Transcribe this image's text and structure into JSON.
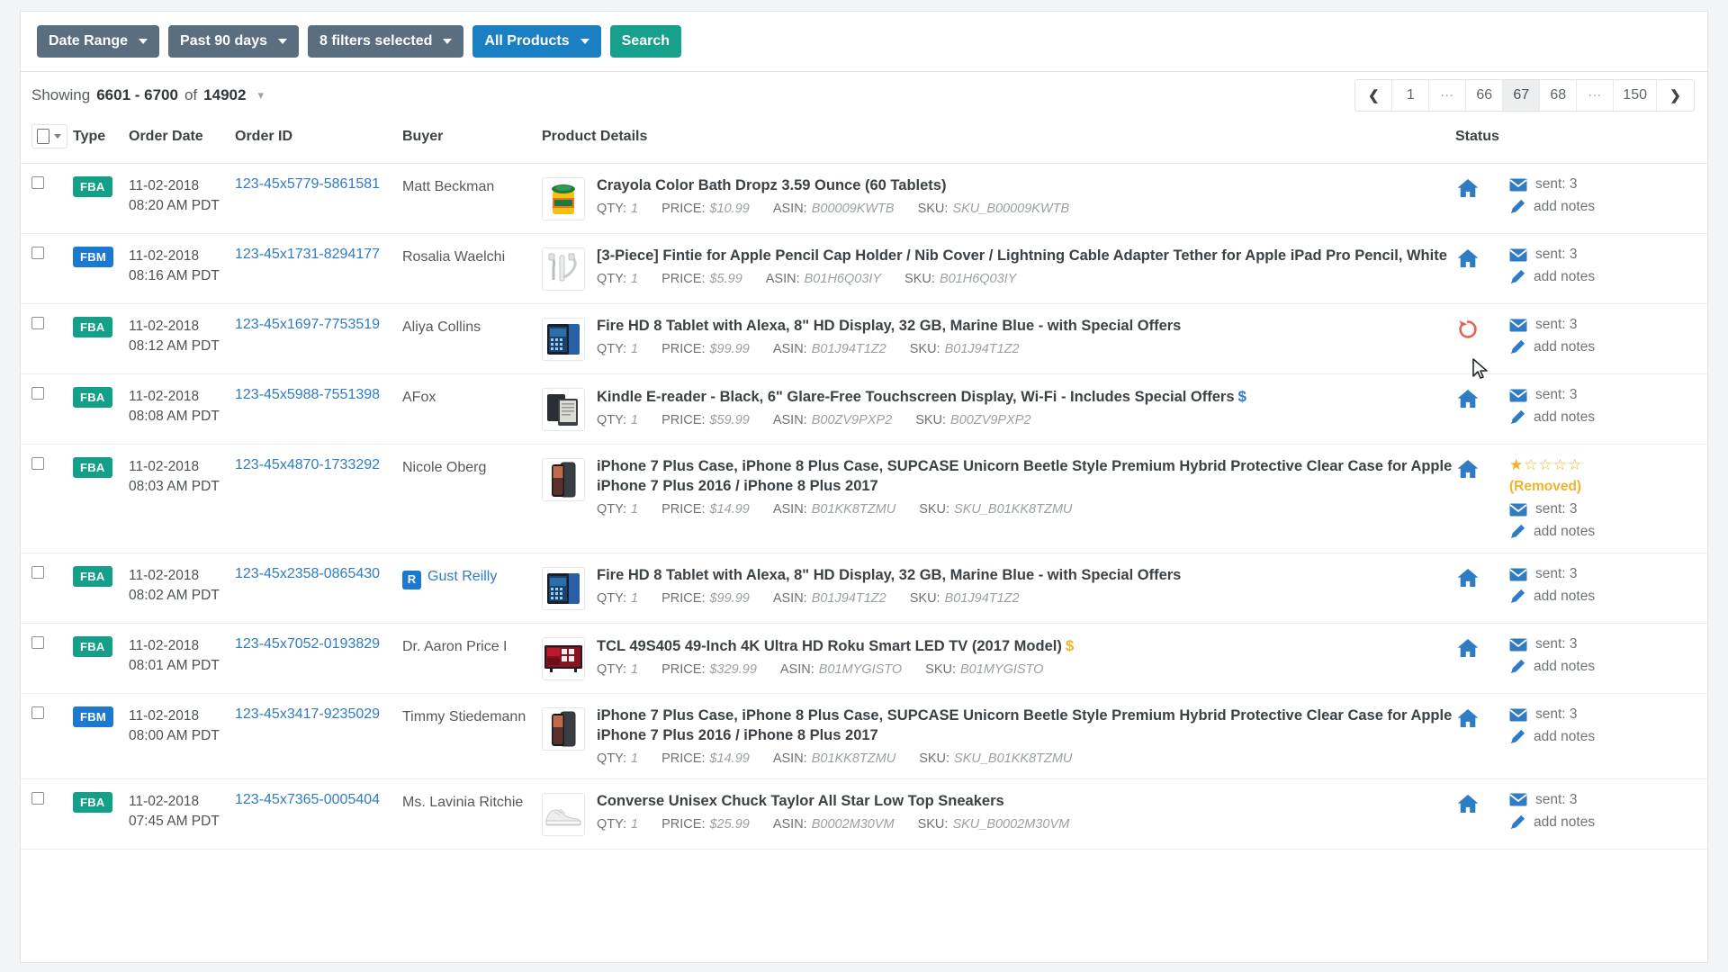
{
  "filters": {
    "date_range_label": "Date Range",
    "period_label": "Past 90 days",
    "filters_label": "8 filters selected",
    "products_label": "All Products",
    "search_label": "Search",
    "colors": {
      "grey": "#5a6e7f",
      "blue": "#1b7fc4",
      "teal": "#17a08c"
    }
  },
  "toolbar": {
    "showing_word": "Showing",
    "range": "6601 - 6700",
    "of_word": "of",
    "total": "14902",
    "pagination": {
      "prev": "‹",
      "next": "›",
      "pages": [
        "1",
        "...",
        "66",
        "67",
        "68",
        "...",
        "150"
      ],
      "active": "67"
    }
  },
  "table": {
    "headers": {
      "type": "Type",
      "order_date": "Order Date",
      "order_id": "Order ID",
      "buyer": "Buyer",
      "product_details": "Product Details",
      "status": "Status"
    },
    "labels": {
      "qty": "QTY:",
      "price": "PRICE:",
      "asin": "ASIN:",
      "sku": "SKU:"
    },
    "rows": [
      {
        "type": "FBA",
        "date": "11-02-2018",
        "time": "08:20 AM PDT",
        "order_id": "123-45x5779-5861581",
        "buyer": "Matt Beckman",
        "buyer_badge": "",
        "thumb": "crayola-bath-dropz-thumb",
        "title": "Crayola Color Bath Dropz 3.59 Ounce (60 Tablets)",
        "dollar": "",
        "qty": "1",
        "price": "$10.99",
        "asin": "B00009KWTB",
        "sku": "SKU_B00009KWTB",
        "status_icon": "home-icon",
        "stars": 0,
        "removed": "",
        "sent": "sent: 3",
        "notes": "add notes"
      },
      {
        "type": "FBM",
        "date": "11-02-2018",
        "time": "08:16 AM PDT",
        "order_id": "123-45x1731-8294177",
        "buyer": "Rosalia Waelchi",
        "buyer_badge": "",
        "thumb": "pencil-cap-holder-thumb",
        "title": "[3-Piece] Fintie for Apple Pencil Cap Holder / Nib Cover / Lightning Cable Adapter Tether for Apple iPad Pro Pencil, White",
        "dollar": "",
        "qty": "1",
        "price": "$5.99",
        "asin": "B01H6Q03IY",
        "sku": "B01H6Q03IY",
        "status_icon": "home-icon",
        "stars": 0,
        "removed": "",
        "sent": "sent: 3",
        "notes": "add notes"
      },
      {
        "type": "FBA",
        "date": "11-02-2018",
        "time": "08:12 AM PDT",
        "order_id": "123-45x1697-7753519",
        "buyer": "Aliya Collins",
        "buyer_badge": "",
        "thumb": "fire-tablet-thumb",
        "title": "Fire HD 8 Tablet with Alexa, 8\" HD Display, 32 GB, Marine Blue - with Special Offers",
        "dollar": "",
        "qty": "1",
        "price": "$99.99",
        "asin": "B01J94T1Z2",
        "sku": "B01J94T1Z2",
        "status_icon": "refund-icon",
        "stars": 0,
        "removed": "",
        "sent": "sent: 3",
        "notes": "add notes"
      },
      {
        "type": "FBA",
        "date": "11-02-2018",
        "time": "08:08 AM PDT",
        "order_id": "123-45x5988-7551398",
        "buyer": "AFox",
        "buyer_badge": "",
        "thumb": "kindle-ereader-thumb",
        "title": "Kindle E-reader - Black, 6\" Glare-Free Touchscreen Display, Wi-Fi - Includes Special Offers",
        "dollar": "blue",
        "qty": "1",
        "price": "$59.99",
        "asin": "B00ZV9PXP2",
        "sku": "B00ZV9PXP2",
        "status_icon": "home-icon",
        "stars": 0,
        "removed": "",
        "sent": "sent: 3",
        "notes": "add notes"
      },
      {
        "type": "FBA",
        "date": "11-02-2018",
        "time": "08:03 AM PDT",
        "order_id": "123-45x4870-1733292",
        "buyer": "Nicole Oberg",
        "buyer_badge": "",
        "thumb": "iphone-case-thumb",
        "title": "iPhone 7 Plus Case, iPhone 8 Plus Case, SUPCASE Unicorn Beetle Style Premium Hybrid Protective Clear Case for Apple iPhone 7 Plus 2016 / iPhone 8 Plus 2017",
        "dollar": "",
        "qty": "1",
        "price": "$14.99",
        "asin": "B01KK8TZMU",
        "sku": "SKU_B01KK8TZMU",
        "status_icon": "home-icon",
        "stars": 1,
        "removed": "(Removed)",
        "sent": "sent: 3",
        "notes": "add notes"
      },
      {
        "type": "FBA",
        "date": "11-02-2018",
        "time": "08:02 AM PDT",
        "order_id": "123-45x2358-0865430",
        "buyer": "Gust Reilly",
        "buyer_badge": "R",
        "thumb": "fire-tablet-thumb",
        "title": "Fire HD 8 Tablet with Alexa, 8\" HD Display, 32 GB, Marine Blue - with Special Offers",
        "dollar": "",
        "qty": "1",
        "price": "$99.99",
        "asin": "B01J94T1Z2",
        "sku": "B01J94T1Z2",
        "status_icon": "home-icon",
        "stars": 0,
        "removed": "",
        "sent": "sent: 3",
        "notes": "add notes"
      },
      {
        "type": "FBA",
        "date": "11-02-2018",
        "time": "08:01 AM PDT",
        "order_id": "123-45x7052-0193829",
        "buyer": "Dr. Aaron Price I",
        "buyer_badge": "",
        "thumb": "tcl-tv-thumb",
        "title": "TCL 49S405 49-Inch 4K Ultra HD Roku Smart LED TV (2017 Model)",
        "dollar": "gold",
        "qty": "1",
        "price": "$329.99",
        "asin": "B01MYGISTO",
        "sku": "B01MYGISTO",
        "status_icon": "home-icon",
        "stars": 0,
        "removed": "",
        "sent": "sent: 3",
        "notes": "add notes"
      },
      {
        "type": "FBM",
        "date": "11-02-2018",
        "time": "08:00 AM PDT",
        "order_id": "123-45x3417-9235029",
        "buyer": "Timmy Stiedemann",
        "buyer_badge": "",
        "thumb": "iphone-case-thumb",
        "title": "iPhone 7 Plus Case, iPhone 8 Plus Case, SUPCASE Unicorn Beetle Style Premium Hybrid Protective Clear Case for Apple iPhone 7 Plus 2016 / iPhone 8 Plus 2017",
        "dollar": "",
        "qty": "1",
        "price": "$14.99",
        "asin": "B01KK8TZMU",
        "sku": "SKU_B01KK8TZMU",
        "status_icon": "home-icon",
        "stars": 0,
        "removed": "",
        "sent": "sent: 3",
        "notes": "add notes"
      },
      {
        "type": "FBA",
        "date": "11-02-2018",
        "time": "07:45 AM PDT",
        "order_id": "123-45x7365-0005404",
        "buyer": "Ms. Lavinia Ritchie",
        "buyer_badge": "",
        "thumb": "converse-sneaker-thumb",
        "title": "Converse Unisex Chuck Taylor All Star Low Top Sneakers",
        "dollar": "",
        "qty": "1",
        "price": "$25.99",
        "asin": "B0002M30VM",
        "sku": "SKU_B0002M30VM",
        "status_icon": "home-icon",
        "stars": 0,
        "removed": "",
        "sent": "sent: 3",
        "notes": "add notes"
      }
    ]
  }
}
